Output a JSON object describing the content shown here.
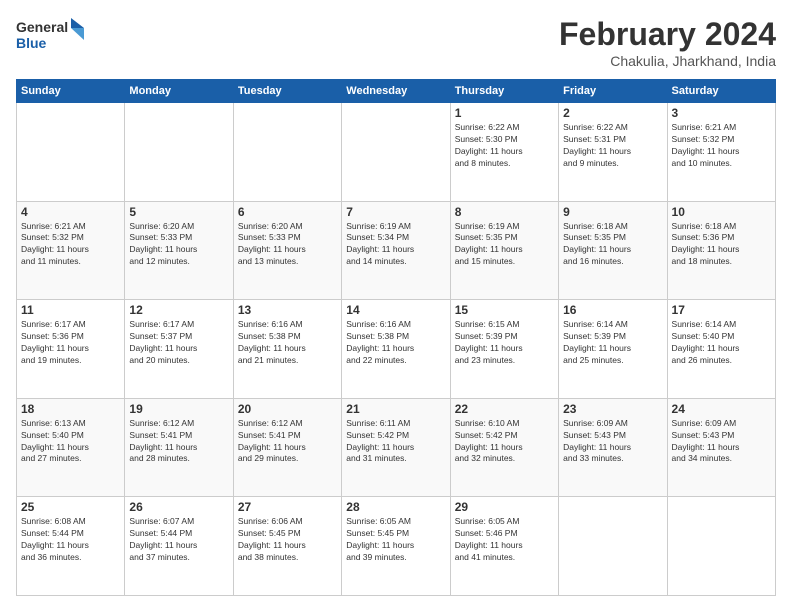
{
  "header": {
    "logo_line1": "General",
    "logo_line2": "Blue",
    "month_title": "February 2024",
    "location": "Chakulia, Jharkhand, India"
  },
  "weekdays": [
    "Sunday",
    "Monday",
    "Tuesday",
    "Wednesday",
    "Thursday",
    "Friday",
    "Saturday"
  ],
  "weeks": [
    [
      {
        "day": "",
        "info": ""
      },
      {
        "day": "",
        "info": ""
      },
      {
        "day": "",
        "info": ""
      },
      {
        "day": "",
        "info": ""
      },
      {
        "day": "1",
        "info": "Sunrise: 6:22 AM\nSunset: 5:30 PM\nDaylight: 11 hours\nand 8 minutes."
      },
      {
        "day": "2",
        "info": "Sunrise: 6:22 AM\nSunset: 5:31 PM\nDaylight: 11 hours\nand 9 minutes."
      },
      {
        "day": "3",
        "info": "Sunrise: 6:21 AM\nSunset: 5:32 PM\nDaylight: 11 hours\nand 10 minutes."
      }
    ],
    [
      {
        "day": "4",
        "info": "Sunrise: 6:21 AM\nSunset: 5:32 PM\nDaylight: 11 hours\nand 11 minutes."
      },
      {
        "day": "5",
        "info": "Sunrise: 6:20 AM\nSunset: 5:33 PM\nDaylight: 11 hours\nand 12 minutes."
      },
      {
        "day": "6",
        "info": "Sunrise: 6:20 AM\nSunset: 5:33 PM\nDaylight: 11 hours\nand 13 minutes."
      },
      {
        "day": "7",
        "info": "Sunrise: 6:19 AM\nSunset: 5:34 PM\nDaylight: 11 hours\nand 14 minutes."
      },
      {
        "day": "8",
        "info": "Sunrise: 6:19 AM\nSunset: 5:35 PM\nDaylight: 11 hours\nand 15 minutes."
      },
      {
        "day": "9",
        "info": "Sunrise: 6:18 AM\nSunset: 5:35 PM\nDaylight: 11 hours\nand 16 minutes."
      },
      {
        "day": "10",
        "info": "Sunrise: 6:18 AM\nSunset: 5:36 PM\nDaylight: 11 hours\nand 18 minutes."
      }
    ],
    [
      {
        "day": "11",
        "info": "Sunrise: 6:17 AM\nSunset: 5:36 PM\nDaylight: 11 hours\nand 19 minutes."
      },
      {
        "day": "12",
        "info": "Sunrise: 6:17 AM\nSunset: 5:37 PM\nDaylight: 11 hours\nand 20 minutes."
      },
      {
        "day": "13",
        "info": "Sunrise: 6:16 AM\nSunset: 5:38 PM\nDaylight: 11 hours\nand 21 minutes."
      },
      {
        "day": "14",
        "info": "Sunrise: 6:16 AM\nSunset: 5:38 PM\nDaylight: 11 hours\nand 22 minutes."
      },
      {
        "day": "15",
        "info": "Sunrise: 6:15 AM\nSunset: 5:39 PM\nDaylight: 11 hours\nand 23 minutes."
      },
      {
        "day": "16",
        "info": "Sunrise: 6:14 AM\nSunset: 5:39 PM\nDaylight: 11 hours\nand 25 minutes."
      },
      {
        "day": "17",
        "info": "Sunrise: 6:14 AM\nSunset: 5:40 PM\nDaylight: 11 hours\nand 26 minutes."
      }
    ],
    [
      {
        "day": "18",
        "info": "Sunrise: 6:13 AM\nSunset: 5:40 PM\nDaylight: 11 hours\nand 27 minutes."
      },
      {
        "day": "19",
        "info": "Sunrise: 6:12 AM\nSunset: 5:41 PM\nDaylight: 11 hours\nand 28 minutes."
      },
      {
        "day": "20",
        "info": "Sunrise: 6:12 AM\nSunset: 5:41 PM\nDaylight: 11 hours\nand 29 minutes."
      },
      {
        "day": "21",
        "info": "Sunrise: 6:11 AM\nSunset: 5:42 PM\nDaylight: 11 hours\nand 31 minutes."
      },
      {
        "day": "22",
        "info": "Sunrise: 6:10 AM\nSunset: 5:42 PM\nDaylight: 11 hours\nand 32 minutes."
      },
      {
        "day": "23",
        "info": "Sunrise: 6:09 AM\nSunset: 5:43 PM\nDaylight: 11 hours\nand 33 minutes."
      },
      {
        "day": "24",
        "info": "Sunrise: 6:09 AM\nSunset: 5:43 PM\nDaylight: 11 hours\nand 34 minutes."
      }
    ],
    [
      {
        "day": "25",
        "info": "Sunrise: 6:08 AM\nSunset: 5:44 PM\nDaylight: 11 hours\nand 36 minutes."
      },
      {
        "day": "26",
        "info": "Sunrise: 6:07 AM\nSunset: 5:44 PM\nDaylight: 11 hours\nand 37 minutes."
      },
      {
        "day": "27",
        "info": "Sunrise: 6:06 AM\nSunset: 5:45 PM\nDaylight: 11 hours\nand 38 minutes."
      },
      {
        "day": "28",
        "info": "Sunrise: 6:05 AM\nSunset: 5:45 PM\nDaylight: 11 hours\nand 39 minutes."
      },
      {
        "day": "29",
        "info": "Sunrise: 6:05 AM\nSunset: 5:46 PM\nDaylight: 11 hours\nand 41 minutes."
      },
      {
        "day": "",
        "info": ""
      },
      {
        "day": "",
        "info": ""
      }
    ]
  ]
}
